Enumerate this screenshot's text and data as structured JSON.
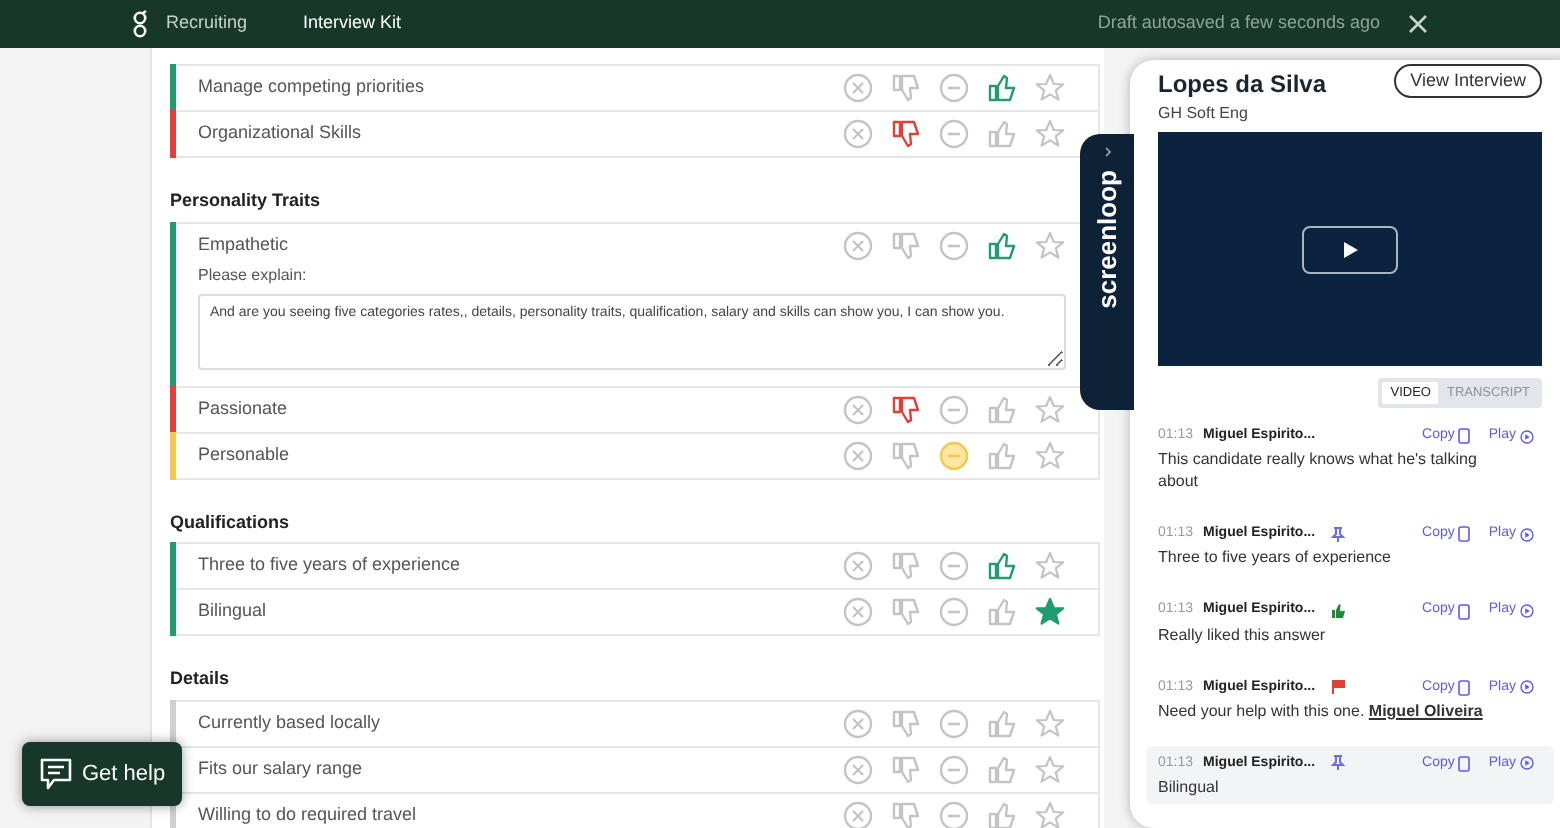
{
  "top_bar": {
    "app": "Recruiting",
    "page": "Interview Kit",
    "status": "Draft autosaved a few seconds ago"
  },
  "sections": [
    {
      "items": [
        {
          "label": "Manage competing priorities",
          "kind": "yes"
        },
        {
          "label": "Organizational Skills",
          "kind": "no"
        }
      ]
    },
    {
      "heading": "Personality Traits",
      "items": [
        {
          "label": "Empathetic",
          "kind": "yes",
          "note_label": "Please explain:",
          "note": "And are you seeing five categories rates,, details, personality traits, qualification, salary and skills can show you, I can show you."
        },
        {
          "label": "Passionate",
          "kind": "no"
        },
        {
          "label": "Personable",
          "kind": "mixed"
        }
      ]
    },
    {
      "heading": "Qualifications",
      "items": [
        {
          "label": "Three to five years of experience",
          "kind": "yes"
        },
        {
          "label": "Bilingual",
          "kind": "strong_yes"
        }
      ]
    },
    {
      "heading": "Details",
      "items": [
        {
          "label": "Currently based locally",
          "kind": "none"
        },
        {
          "label": "Fits our salary range",
          "kind": "none"
        },
        {
          "label": "Willing to do required travel",
          "kind": "none"
        }
      ]
    }
  ],
  "side_tab": {
    "brand": "screenloop"
  },
  "panel": {
    "name": "Lopes da Silva",
    "job": "GH Soft Eng",
    "view_button": "View Interview",
    "tabs": [
      {
        "label": "VIDEO",
        "selected": true
      },
      {
        "label": "TRANSCRIPT",
        "selected": false
      }
    ],
    "entries": [
      {
        "time": "01:13",
        "author": "Miguel Espirito...",
        "kind": "none",
        "copy": "Copy",
        "play": "Play",
        "text": "This candidate really knows what he's talking about",
        "selected": false
      },
      {
        "time": "01:13",
        "author": "Miguel Espirito...",
        "kind": "pin",
        "copy": "Copy",
        "play": "Play",
        "text": "Three to five years of experience",
        "selected": false
      },
      {
        "time": "01:13",
        "author": "Miguel Espirito...",
        "kind": "thumb",
        "copy": "Copy",
        "play": "Play",
        "text": "Really liked this answer",
        "selected": false
      },
      {
        "time": "01:13",
        "author": "Miguel Espirito...",
        "kind": "flag",
        "copy": "Copy",
        "play": "Play",
        "text": "Need your help with this one.",
        "mention": "Miguel Oliveira",
        "selected": false
      },
      {
        "time": "01:13",
        "author": "Miguel Espirito...",
        "kind": "pin",
        "copy": "Copy",
        "play": "Play",
        "text": "Bilingual",
        "selected": true
      }
    ]
  },
  "help_button": "Get help"
}
